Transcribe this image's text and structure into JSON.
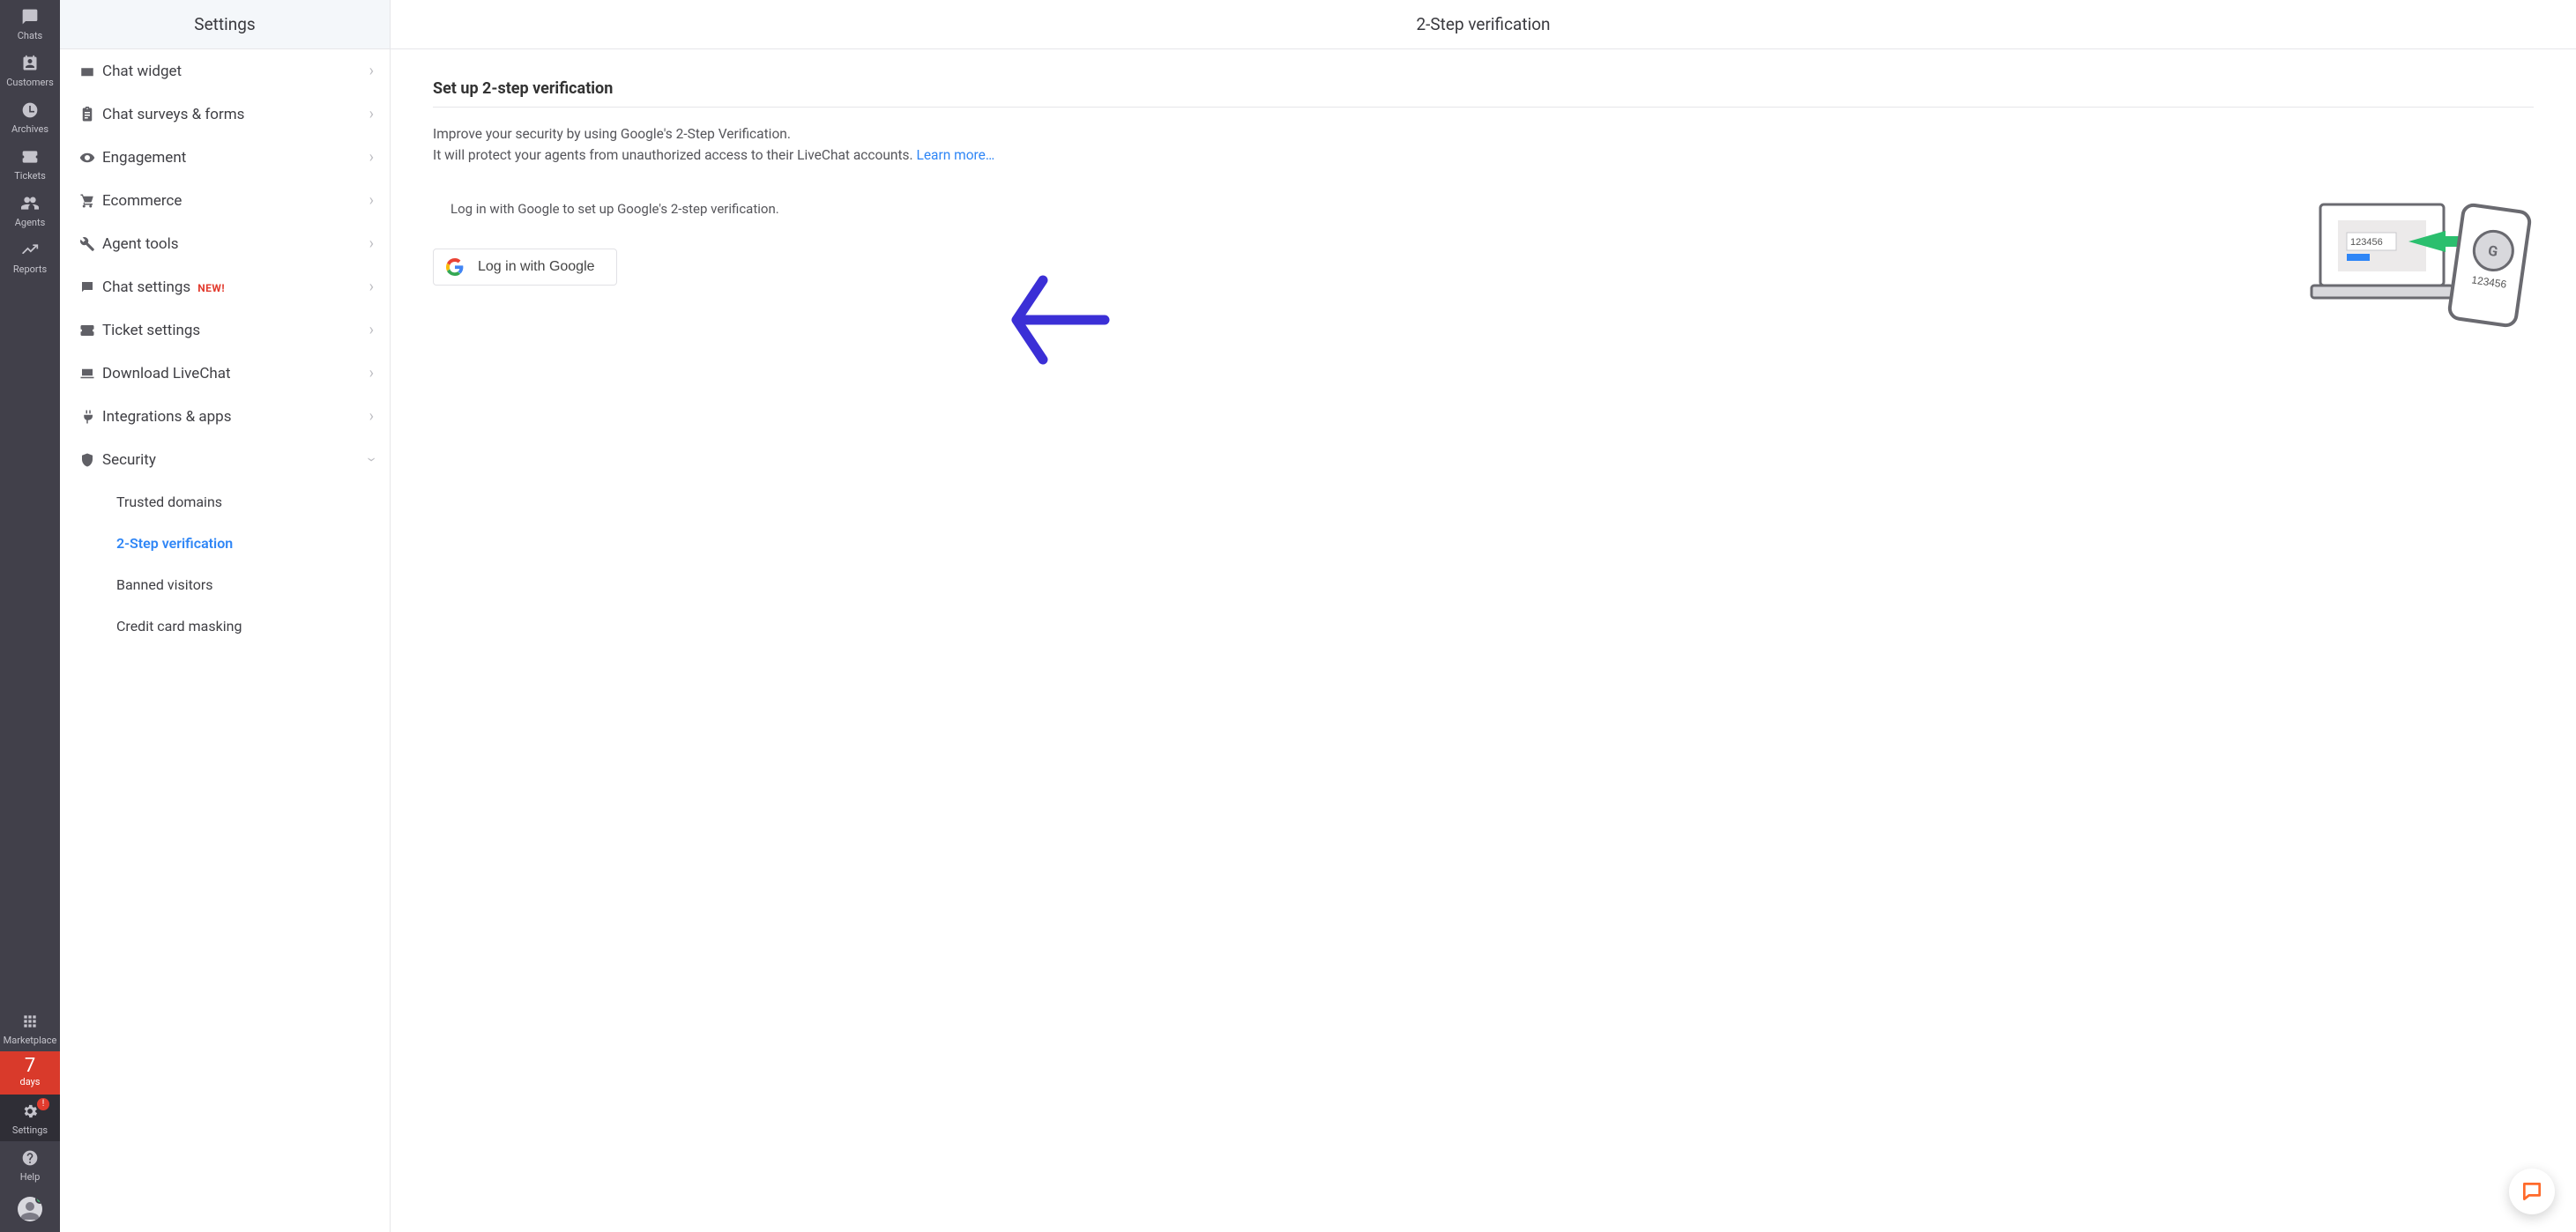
{
  "rail": {
    "items": [
      {
        "label": "Chats"
      },
      {
        "label": "Customers"
      },
      {
        "label": "Archives"
      },
      {
        "label": "Tickets"
      },
      {
        "label": "Agents"
      },
      {
        "label": "Reports"
      }
    ],
    "marketplace_label": "Marketplace",
    "trial": {
      "count": "7",
      "label": "days"
    },
    "settings_label": "Settings",
    "settings_badge": "!",
    "help_label": "Help"
  },
  "sidebar": {
    "title": "Settings",
    "menu": [
      {
        "label": "Chat widget"
      },
      {
        "label": "Chat surveys & forms"
      },
      {
        "label": "Engagement"
      },
      {
        "label": "Ecommerce"
      },
      {
        "label": "Agent tools"
      },
      {
        "label": "Chat settings",
        "tag": "NEW!"
      },
      {
        "label": "Ticket settings"
      },
      {
        "label": "Download LiveChat"
      },
      {
        "label": "Integrations & apps"
      },
      {
        "label": "Security"
      }
    ],
    "security_sub": [
      {
        "label": "Trusted domains"
      },
      {
        "label": "2-Step verification",
        "active": true
      },
      {
        "label": "Banned visitors"
      },
      {
        "label": "Credit card masking"
      }
    ]
  },
  "main": {
    "header": "2-Step verification",
    "section_title": "Set up 2-step verification",
    "desc_line1": "Improve your security by using Google's 2-Step Verification.",
    "desc_line2_pre": "It will protect your agents from unauthorized access to their LiveChat accounts. ",
    "learn_more": "Learn more…",
    "login_hint": "Log in with Google to set up Google's 2-step verification.",
    "google_button": "Log in with Google",
    "illus_code": "123456"
  }
}
